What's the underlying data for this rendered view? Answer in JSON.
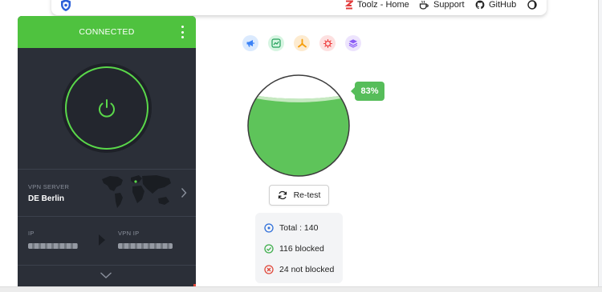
{
  "nav": {
    "logo_icon": "shield-logo-icon",
    "items": [
      {
        "label": "Toolz - Home",
        "icon": "toolz-z-icon"
      },
      {
        "label": "Support",
        "icon": "coffee-icon"
      },
      {
        "label": "GitHub",
        "icon": "github-icon"
      },
      {
        "label": "",
        "icon": "theme-toggle-icon"
      }
    ]
  },
  "vpn": {
    "status": "CONNECTED",
    "server_label": "VPN SERVER",
    "server_value": "DE Berlin",
    "ip_label": "IP",
    "vpn_ip_label": "VPN IP",
    "colors": {
      "header": "#4fc23f",
      "ring": "#5ad84a",
      "panel": "#2b2f38"
    }
  },
  "tools": [
    {
      "icon": "megaphone-icon",
      "color": "#3b82f6",
      "bg": "#dbeafe"
    },
    {
      "icon": "chart-icon",
      "color": "#22a05a",
      "bg": "#d7f5e2"
    },
    {
      "icon": "biohazard-icon",
      "color": "#f59e0b",
      "bg": "#fdebd0"
    },
    {
      "icon": "virus-icon",
      "color": "#ef4444",
      "bg": "#fde0e0"
    },
    {
      "icon": "layers-icon",
      "color": "#8b5cf6",
      "bg": "#ede4fd"
    }
  ],
  "result": {
    "percent_label": "83%",
    "fill_fraction": 0.83,
    "fill_color": "#5ec45a",
    "retest_label": "Re-test",
    "total": "Total : 140",
    "blocked": "116 blocked",
    "not_blocked": "24 not blocked"
  }
}
